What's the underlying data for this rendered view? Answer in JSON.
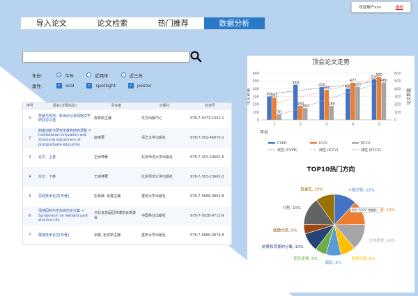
{
  "header": {
    "welcome": "欢迎用户xxx",
    "logout": "退出"
  },
  "nav": {
    "tabs": [
      "导入论文",
      "论文检索",
      "热门推荐",
      "数据分析"
    ]
  },
  "search": {
    "placeholder": ""
  },
  "filters": {
    "year_label": "年份:",
    "year_options": [
      "今年",
      "近两年",
      "近三年"
    ],
    "year_selected": "今年",
    "attr_label": "属性:",
    "attr_options": [
      "oral",
      "spotlight",
      "poster"
    ]
  },
  "table": {
    "headers": [
      "序号",
      "题名(详细信息)",
      "责任者",
      "出版社",
      "标准号"
    ],
    "rows": [
      [
        "1",
        "突破与规范：新世纪以来网络文学研究论文选",
        "詹新娟主编",
        "东方出版中心",
        "978-7-5473-1341-1"
      ],
      [
        "2",
        "制度创新与研究生教育结构调整 = Institutional innovation and structural adjustment of postgraduate education",
        "赵琳著",
        "清华大学出版社",
        "978-7-302-46070-1"
      ],
      [
        "3",
        "论文．上卷",
        "王树坤著",
        "北京师范大学出版社",
        "978-7-303-23662-6"
      ],
      [
        "4",
        "论文．下卷",
        "王树坤著",
        "北京师范大学出版社",
        "978-7-303-23663-3"
      ],
      [
        "5",
        "思政技术论文[专著]",
        "彭美辉, 余鑫主编",
        "重庆大学出版社",
        "978-7-5689-0894-8"
      ],
      [
        "6",
        "湿地园林与生态城市论文集 = Symposium on wetland park and eco-city",
        "河北省首届园林博览会筹委会",
        "中国林业出版社",
        "978-7-5038-9713-9"
      ],
      [
        "7",
        "隧道技术论文[专著]",
        "余鑫, 张志新主编",
        "重庆大学出版社",
        "978-7-5689-0878-8"
      ]
    ]
  },
  "chart_data": [
    {
      "type": "bar",
      "title": "顶会论文走势",
      "xlabel": "年份",
      "ylabel": "论文数量",
      "categories": [
        "1",
        "2",
        "3",
        "4",
        "5"
      ],
      "ylim": [
        0,
        600
      ],
      "series": [
        {
          "name": "CVPR",
          "values": [
            300,
            450,
            420,
            400,
            520
          ],
          "color": "#4472c4"
        },
        {
          "name": "ICCV",
          "values": [
            285,
            180,
            385,
            477,
            550
          ],
          "color": "#ed7d31"
        },
        {
          "name": "ECCV",
          "values": [
            70,
            150,
            180,
            422,
            480
          ],
          "color": "#a5a5a5"
        }
      ],
      "trendlines": [
        "线性 (CVPR)",
        "线性 (ICCV)",
        "线性 (ECCV)"
      ],
      "data_labels": [
        "300",
        "285",
        "70",
        "450",
        "180",
        "150",
        "420",
        "385",
        "180",
        "400",
        "477",
        "422",
        "520",
        "550",
        "480"
      ],
      "legend": "bottom"
    },
    {
      "type": "pie",
      "title": "TOP10热门方向",
      "categories": [
        "人脸识别",
        "图像恢复",
        "立体视觉",
        "视频问题",
        "跟踪",
        "图形变换",
        "前景和背景的分离",
        "图像分类",
        "分割",
        "显著性"
      ],
      "values": [
        12,
        13,
        14,
        8,
        8,
        6,
        10,
        5,
        15,
        10
      ],
      "labels": [
        "人脸识别, 12%",
        "图像恢复, 13%",
        "立体视觉, 14%",
        "视频问题, 8%",
        "跟踪, 8%",
        "图形变换, 6%",
        "前景和背景的分离, 10%",
        "图像分类, 5%",
        "分割, 15%",
        "显著性, 10%"
      ],
      "colors": [
        "#4472c4",
        "#ed7d31",
        "#a5a5a5",
        "#ffc000",
        "#5b9bd5",
        "#70ad47",
        "#264478",
        "#9e480e",
        "#636363",
        "#997300"
      ],
      "tooltip": "系列 \"ICCV\" 数据标"
    }
  ]
}
